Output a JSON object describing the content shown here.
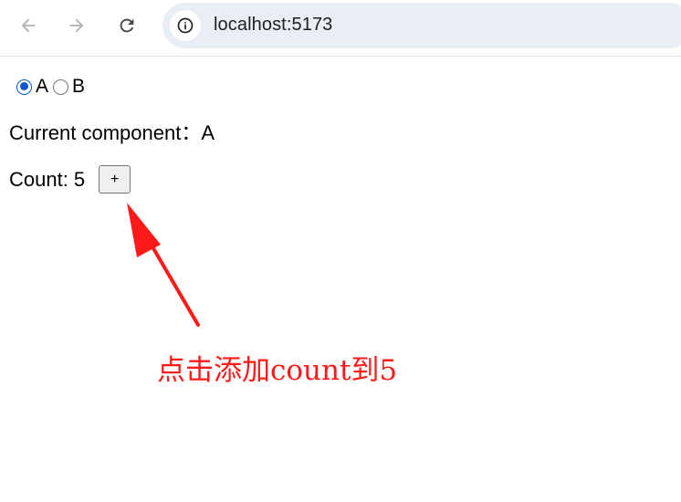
{
  "browser": {
    "url": "localhost:5173",
    "icons": {
      "back": "arrow-back-icon",
      "forward": "arrow-forward-icon",
      "reload": "reload-icon",
      "site_info": "info-icon"
    }
  },
  "page": {
    "radios": [
      {
        "label": "A",
        "checked": true
      },
      {
        "label": "B",
        "checked": false
      }
    ],
    "current_component_text": "Current component：A",
    "count_text": "Count: 5",
    "increment_label": "+"
  },
  "annotation": {
    "text": "点击添加count到5",
    "color": "#ff1a1a"
  },
  "colors": {
    "radio_accent": "#0b57d0",
    "omnibox_bg": "#e9eef6"
  }
}
